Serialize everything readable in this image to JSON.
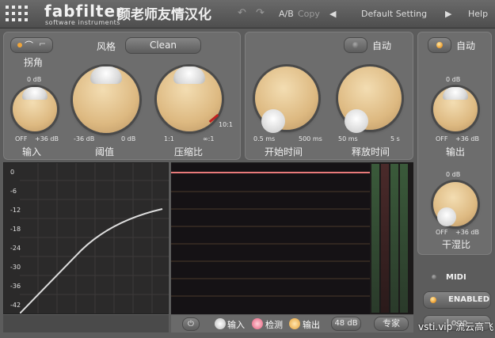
{
  "header": {
    "brand": "fabfilter",
    "brand_sub": "software instruments",
    "brand_cn": "颜老师友情汉化",
    "ab": "A/B",
    "copy": "Copy",
    "preset": "Default Setting",
    "help": "Help"
  },
  "panel_left": {
    "knee_label": "拐角",
    "style_label": "风格",
    "style_value": "Clean",
    "input": {
      "label": "输入",
      "top": "0 dB",
      "min": "OFF",
      "max": "+36 dB"
    },
    "threshold": {
      "label": "阈值",
      "min": "-36 dB",
      "max": "0 dB"
    },
    "ratio": {
      "label": "压缩比",
      "min": "1:1",
      "max": "∞:1",
      "value": "10:1"
    }
  },
  "panel_mid": {
    "auto": "自动",
    "attack": {
      "label": "开始时间",
      "min": "0.5 ms",
      "max": "500 ms"
    },
    "release": {
      "label": "释放时间",
      "min": "50 ms",
      "max": "5 s"
    }
  },
  "panel_right": {
    "auto": "自动",
    "output": {
      "label": "输出",
      "top": "0 dB",
      "min": "OFF",
      "max": "+36 dB"
    },
    "drywet": {
      "label": "干湿比",
      "top": "0 dB",
      "min": "OFF",
      "max": "+36 dB"
    }
  },
  "graph": {
    "y_labels": [
      "0",
      "-6",
      "-12",
      "-18",
      "-24",
      "-30",
      "-36",
      "-42"
    ]
  },
  "bottombar": {
    "input": "输入",
    "detect": "检测",
    "output": "输出",
    "range": "48 dB",
    "expert": "专家"
  },
  "side": {
    "midi": "MIDI",
    "enabled": "ENABLED",
    "logo": "Logo"
  },
  "watermark": "vsti.vip 流云高飞",
  "colors": {
    "knob": "#ddb981",
    "accent": "#f0a53a",
    "scope_line": "#e87a7a",
    "curve": "#dcdcdc"
  }
}
